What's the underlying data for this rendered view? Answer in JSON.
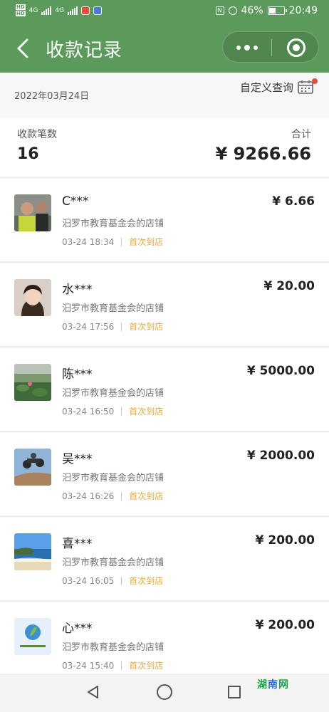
{
  "statusbar": {
    "battery": "46%",
    "time": "20:49",
    "hd1": "HD",
    "hd2": "HD",
    "net1": "4G",
    "net2": "4G"
  },
  "nav": {
    "title": "收款记录"
  },
  "filter": {
    "date": "2022年03月24日",
    "custom_query": "自定义查询"
  },
  "summary": {
    "count_label": "收款笔数",
    "count": "16",
    "total_label": "合计",
    "total": "¥ 9266.66"
  },
  "records": [
    {
      "name": "C***",
      "amount": "¥ 6.66",
      "store": "汨罗市教育基金会的店铺",
      "time": "03-24 18:34",
      "badge": "首次到店",
      "avatar": "person-photo"
    },
    {
      "name": "水***",
      "amount": "¥ 20.00",
      "store": "汨罗市教育基金会的店铺",
      "time": "03-24 17:56",
      "badge": "首次到店",
      "avatar": "selfie-photo"
    },
    {
      "name": "陈***",
      "amount": "¥ 5000.00",
      "store": "汨罗市教育基金会的店铺",
      "time": "03-24 16:50",
      "badge": "首次到店",
      "avatar": "lotus-pond-photo"
    },
    {
      "name": "吴***",
      "amount": "¥ 2000.00",
      "store": "汨罗市教育基金会的店铺",
      "time": "03-24 16:26",
      "badge": "首次到店",
      "avatar": "atv-photo"
    },
    {
      "name": "喜***",
      "amount": "¥ 200.00",
      "store": "汨罗市教育基金会的店铺",
      "time": "03-24 16:05",
      "badge": "首次到店",
      "avatar": "beach-photo"
    },
    {
      "name": "心***",
      "amount": "¥ 200.00",
      "store": "汨罗市教育基金会的店铺",
      "time": "03-24 15:40",
      "badge": "首次到店",
      "avatar": "leaf-logo"
    }
  ],
  "watermark": {
    "part1": "湖",
    "part2": "南",
    "part3": "网"
  },
  "colors": {
    "header": "#5b9a5b",
    "badge": "#e5a93a",
    "dot": "#e84b3c"
  }
}
